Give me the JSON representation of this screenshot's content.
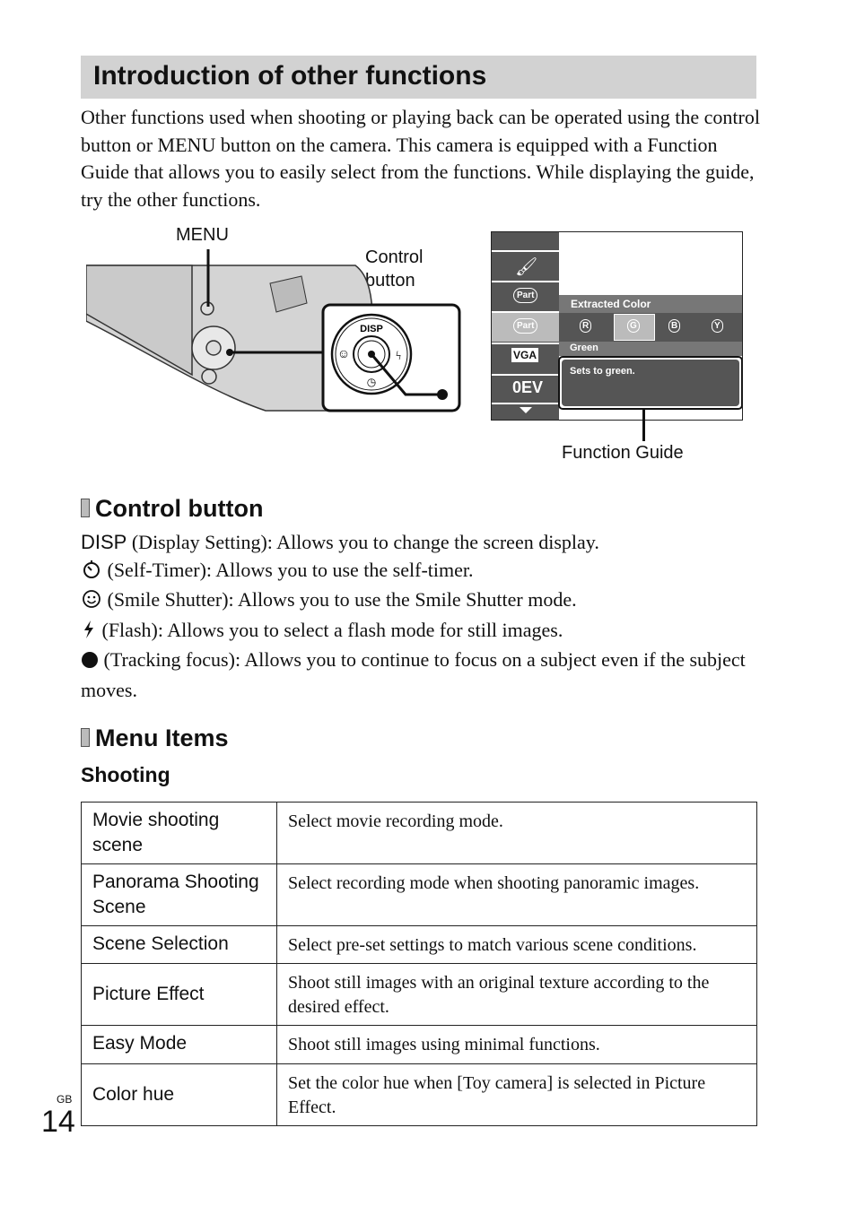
{
  "heading": "Introduction of other functions",
  "intro": "Other functions used when shooting or playing back can be operated using the control button or MENU button on the camera. This camera is equipped with a Function Guide that allows you to easily select from the functions. While displaying the guide, try the other functions.",
  "figure": {
    "menu_label": "MENU",
    "control_label_1": "Control",
    "control_label_2": "button",
    "disp_label": "DISP",
    "function_guide_label": "Function Guide",
    "screen": {
      "extracted_color": "Extracted Color",
      "part_label": "Part",
      "options": [
        "R",
        "G",
        "B",
        "Y"
      ],
      "selected": "G",
      "color_name": "Green",
      "guide_text": "Sets to green.",
      "vga": "VGA",
      "ev": "0EV"
    }
  },
  "control_button": {
    "title": "Control button",
    "items": [
      {
        "key": "DISP",
        "icon": "disp",
        "text": " (Display Setting): Allows you to change the screen display."
      },
      {
        "key": "",
        "icon": "self-timer-icon",
        "text": " (Self-Timer): Allows you to use the self-timer."
      },
      {
        "key": "",
        "icon": "smile-icon",
        "text": " (Smile Shutter): Allows you to use the Smile Shutter mode."
      },
      {
        "key": "",
        "icon": "flash-icon",
        "text": " (Flash): Allows you to select a flash mode for still images."
      },
      {
        "key": "",
        "icon": "tracking-dot-icon",
        "text": " (Tracking focus): Allows you to continue to focus on a subject even if the subject moves."
      }
    ]
  },
  "menu_items": {
    "title": "Menu Items",
    "subtitle": "Shooting",
    "rows": [
      {
        "name": "Movie shooting scene",
        "desc": "Select movie recording mode."
      },
      {
        "name": "Panorama Shooting Scene",
        "desc": "Select recording mode when shooting panoramic images."
      },
      {
        "name": "Scene Selection",
        "desc": "Select pre-set settings to match various scene conditions."
      },
      {
        "name": "Picture Effect",
        "desc": "Shoot still images with an original texture according to the desired effect."
      },
      {
        "name": "Easy Mode",
        "desc": "Shoot still images using minimal functions."
      },
      {
        "name": "Color hue",
        "desc": "Set the color hue when [Toy camera] is selected in Picture Effect."
      }
    ]
  },
  "footer": {
    "region": "GB",
    "page": "14"
  }
}
